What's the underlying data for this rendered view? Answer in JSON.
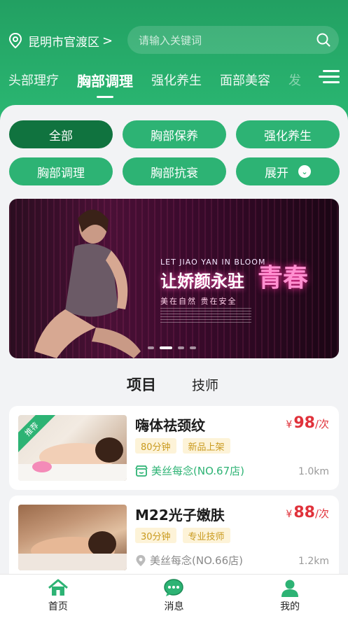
{
  "header": {
    "location": "昆明市官渡区",
    "location_chevron": ">",
    "search_placeholder": "请输入关键词",
    "categories": [
      "头部理疗",
      "胸部调理",
      "强化养生",
      "面部美容",
      "发"
    ]
  },
  "chips": [
    {
      "label": "全部"
    },
    {
      "label": "胸部保养"
    },
    {
      "label": "强化养生"
    },
    {
      "label": "胸部调理"
    },
    {
      "label": "胸部抗衰"
    },
    {
      "label": "展开"
    }
  ],
  "banner": {
    "en_text": "LET JIAO YAN IN BLOOM",
    "headline": "让娇颜永驻",
    "headline_big": "青春",
    "subline": "美在自然  贵在安全"
  },
  "tabs": {
    "items": "项目",
    "techs": "技师"
  },
  "cards": [
    {
      "ribbon": "推荐",
      "title": "嗨体祛颈纹",
      "badges": [
        "80分钟",
        "新品上架"
      ],
      "currency": "¥",
      "price": "98",
      "unit": "/次",
      "store": "美丝每念(NO.67店)",
      "distance": "1.0km"
    },
    {
      "title": "M22光子嫩肤",
      "badges": [
        "30分钟",
        "专业技师"
      ],
      "currency": "¥",
      "price": "88",
      "unit": "/次",
      "store": "美丝每念(NO.66店)",
      "distance": "1.2km"
    }
  ],
  "navbar": {
    "home": "首页",
    "messages": "消息",
    "mine": "我的"
  },
  "colors": {
    "brand": "#2db374",
    "brand_dark": "#10733f",
    "price": "#e0323b"
  },
  "icons": [
    "location-pin-icon",
    "search-icon",
    "menu-icon",
    "chevron-down-icon",
    "store-icon",
    "home-icon",
    "message-icon",
    "user-icon"
  ]
}
